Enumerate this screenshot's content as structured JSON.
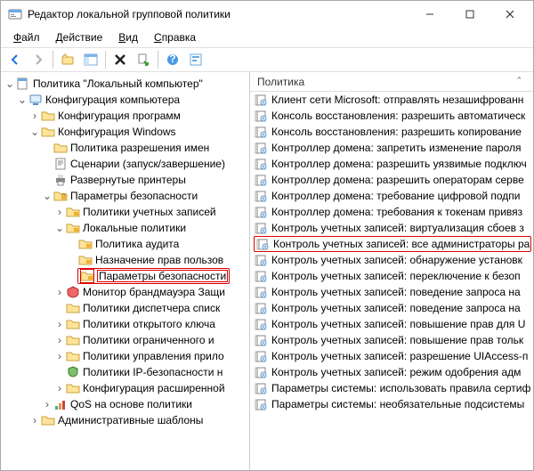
{
  "window": {
    "title": "Редактор локальной групповой политики"
  },
  "menubar": {
    "file": "Файл",
    "action": "Действие",
    "view": "Вид",
    "help": "Справка"
  },
  "tree": {
    "root": "Политика \"Локальный компьютер\"",
    "computer_config": "Конфигурация компьютера",
    "software_settings": "Конфигурация программ",
    "windows_config": "Конфигурация Windows",
    "name_res_policy": "Политика разрешения имен",
    "scripts": "Сценарии (запуск/завершение)",
    "deployed_printers": "Развернутые принтеры",
    "security_settings": "Параметры безопасности",
    "account_policies": "Политики учетных записей",
    "local_policies": "Локальные политики",
    "audit_policy": "Политика аудита",
    "user_rights": "Назначение прав пользов",
    "security_options": "Параметры безопасности",
    "firewall_monitor": "Монитор брандмауэра Защи",
    "nlm_policies": "Политики диспетчера списк",
    "public_key": "Политики открытого ключа",
    "software_restriction": "Политики ограниченного и",
    "app_control": "Политики управления прило",
    "ip_security": "Политики IP-безопасности н",
    "advanced_audit": "Конфигурация расширенной",
    "qos": "QoS на основе политики",
    "admin_templates": "Административные шаблоны"
  },
  "list": {
    "header": "Политика",
    "items": [
      "Клиент сети Microsoft: отправлять незашифрованн",
      "Консоль восстановления: разрешить автоматическ",
      "Консоль восстановления: разрешить копирование",
      "Контроллер домена: запретить изменение пароля",
      "Контроллер домена: разрешить уязвимые подключ",
      "Контроллер домена: разрешить операторам серве",
      "Контроллер домена: требование цифровой подпи",
      "Контроллер домена: требования к токенам привяз",
      "Контроль учетных записей: виртуализация сбоев з",
      "Контроль учетных записей: все администраторы ра",
      "Контроль учетных записей: обнаружение установк",
      "Контроль учетных записей: переключение к безоп",
      "Контроль учетных записей: поведение запроса на",
      "Контроль учетных записей: поведение запроса на",
      "Контроль учетных записей: повышение прав для U",
      "Контроль учетных записей: повышение прав тольк",
      "Контроль учетных записей: разрешение UIAccess-п",
      "Контроль учетных записей: режим одобрения адм",
      "Параметры системы: использовать правила сертиф",
      "Параметры системы: необязательные подсистемы"
    ],
    "selected_index": 9
  }
}
